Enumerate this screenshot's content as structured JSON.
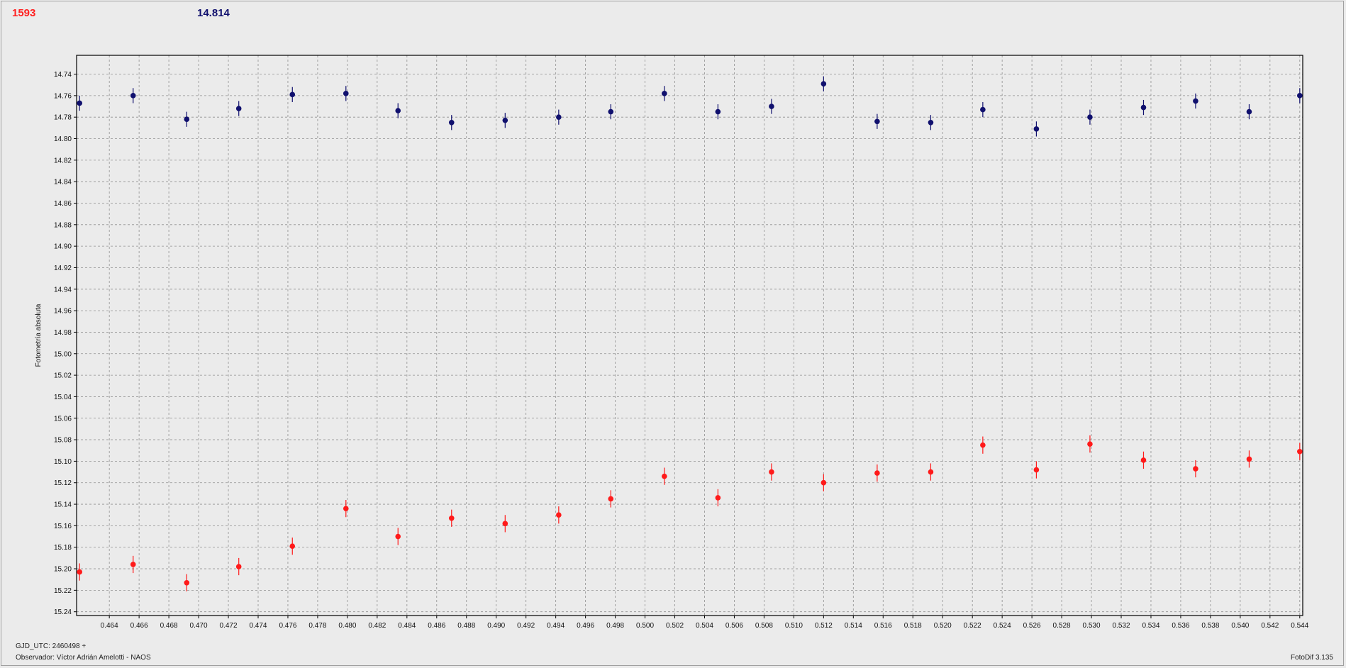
{
  "header": {
    "id_value": "1593",
    "magnitude_value": "14.814"
  },
  "footer": {
    "date_text": "GJD_UTC: 2460498 +",
    "observer_text": "Observador: Víctor Adrián Amelotti - NAOS",
    "software_text": "FotoDif 3.135"
  },
  "colors": {
    "series_red": "#ff1a1a",
    "series_blue": "#10106e",
    "background": "#ebebeb",
    "grid": "#909090"
  },
  "chart_data": {
    "type": "scatter",
    "title": "",
    "xlabel": "",
    "ylabel": "Fotometría absoluta",
    "xlim": [
      0.4618,
      0.5442
    ],
    "ylim": [
      14.7225,
      15.2435
    ],
    "y_inverted": true,
    "grid": true,
    "x_ticks": [
      "0.464",
      "0.466",
      "0.468",
      "0.470",
      "0.472",
      "0.474",
      "0.476",
      "0.478",
      "0.480",
      "0.482",
      "0.484",
      "0.486",
      "0.488",
      "0.490",
      "0.492",
      "0.494",
      "0.496",
      "0.498",
      "0.500",
      "0.502",
      "0.504",
      "0.506",
      "0.508",
      "0.510",
      "0.512",
      "0.514",
      "0.516",
      "0.518",
      "0.520",
      "0.522",
      "0.524",
      "0.526",
      "0.528",
      "0.530",
      "0.532",
      "0.534",
      "0.536",
      "0.538",
      "0.540",
      "0.542",
      "0.544"
    ],
    "y_ticks": [
      "14.74",
      "14.76",
      "14.78",
      "14.80",
      "14.82",
      "14.84",
      "14.86",
      "14.88",
      "14.90",
      "14.92",
      "14.94",
      "14.96",
      "14.98",
      "15.00",
      "15.02",
      "15.04",
      "15.06",
      "15.08",
      "15.10",
      "15.12",
      "15.14",
      "15.16",
      "15.18",
      "15.20",
      "15.22",
      "15.24"
    ],
    "series": [
      {
        "color": "#10106e",
        "x": [
          0.462,
          0.4656,
          0.4692,
          0.4727,
          0.4763,
          0.4799,
          0.4834,
          0.487,
          0.4906,
          0.4942,
          0.4977,
          0.5013,
          0.5049,
          0.5085,
          0.512,
          0.5156,
          0.5192,
          0.5227,
          0.5263,
          0.5299,
          0.5335,
          0.537,
          0.5406,
          0.544
        ],
        "y": [
          14.767,
          14.76,
          14.782,
          14.772,
          14.759,
          14.758,
          14.774,
          14.785,
          14.783,
          14.78,
          14.775,
          14.758,
          14.775,
          14.77,
          14.749,
          14.784,
          14.785,
          14.773,
          14.791,
          14.78,
          14.771,
          14.765,
          14.775,
          14.76
        ],
        "err": [
          0.007,
          0.007,
          0.007,
          0.007,
          0.007,
          0.007,
          0.007,
          0.007,
          0.007,
          0.007,
          0.007,
          0.007,
          0.007,
          0.007,
          0.007,
          0.007,
          0.007,
          0.007,
          0.007,
          0.007,
          0.007,
          0.007,
          0.007,
          0.007
        ]
      },
      {
        "color": "#ff1a1a",
        "x": [
          0.462,
          0.4656,
          0.4692,
          0.4727,
          0.4763,
          0.4799,
          0.4834,
          0.487,
          0.4906,
          0.4942,
          0.4977,
          0.5013,
          0.5049,
          0.5085,
          0.512,
          0.5156,
          0.5192,
          0.5227,
          0.5263,
          0.5299,
          0.5335,
          0.537,
          0.5406,
          0.544
        ],
        "y": [
          15.203,
          15.196,
          15.213,
          15.198,
          15.179,
          15.144,
          15.17,
          15.153,
          15.158,
          15.15,
          15.135,
          15.114,
          15.134,
          15.11,
          15.12,
          15.111,
          15.11,
          15.085,
          15.108,
          15.084,
          15.099,
          15.107,
          15.098,
          15.091
        ],
        "err": [
          0.008,
          0.008,
          0.008,
          0.008,
          0.008,
          0.008,
          0.008,
          0.008,
          0.008,
          0.008,
          0.008,
          0.008,
          0.008,
          0.008,
          0.008,
          0.008,
          0.008,
          0.008,
          0.008,
          0.008,
          0.008,
          0.008,
          0.008,
          0.008
        ]
      }
    ]
  }
}
